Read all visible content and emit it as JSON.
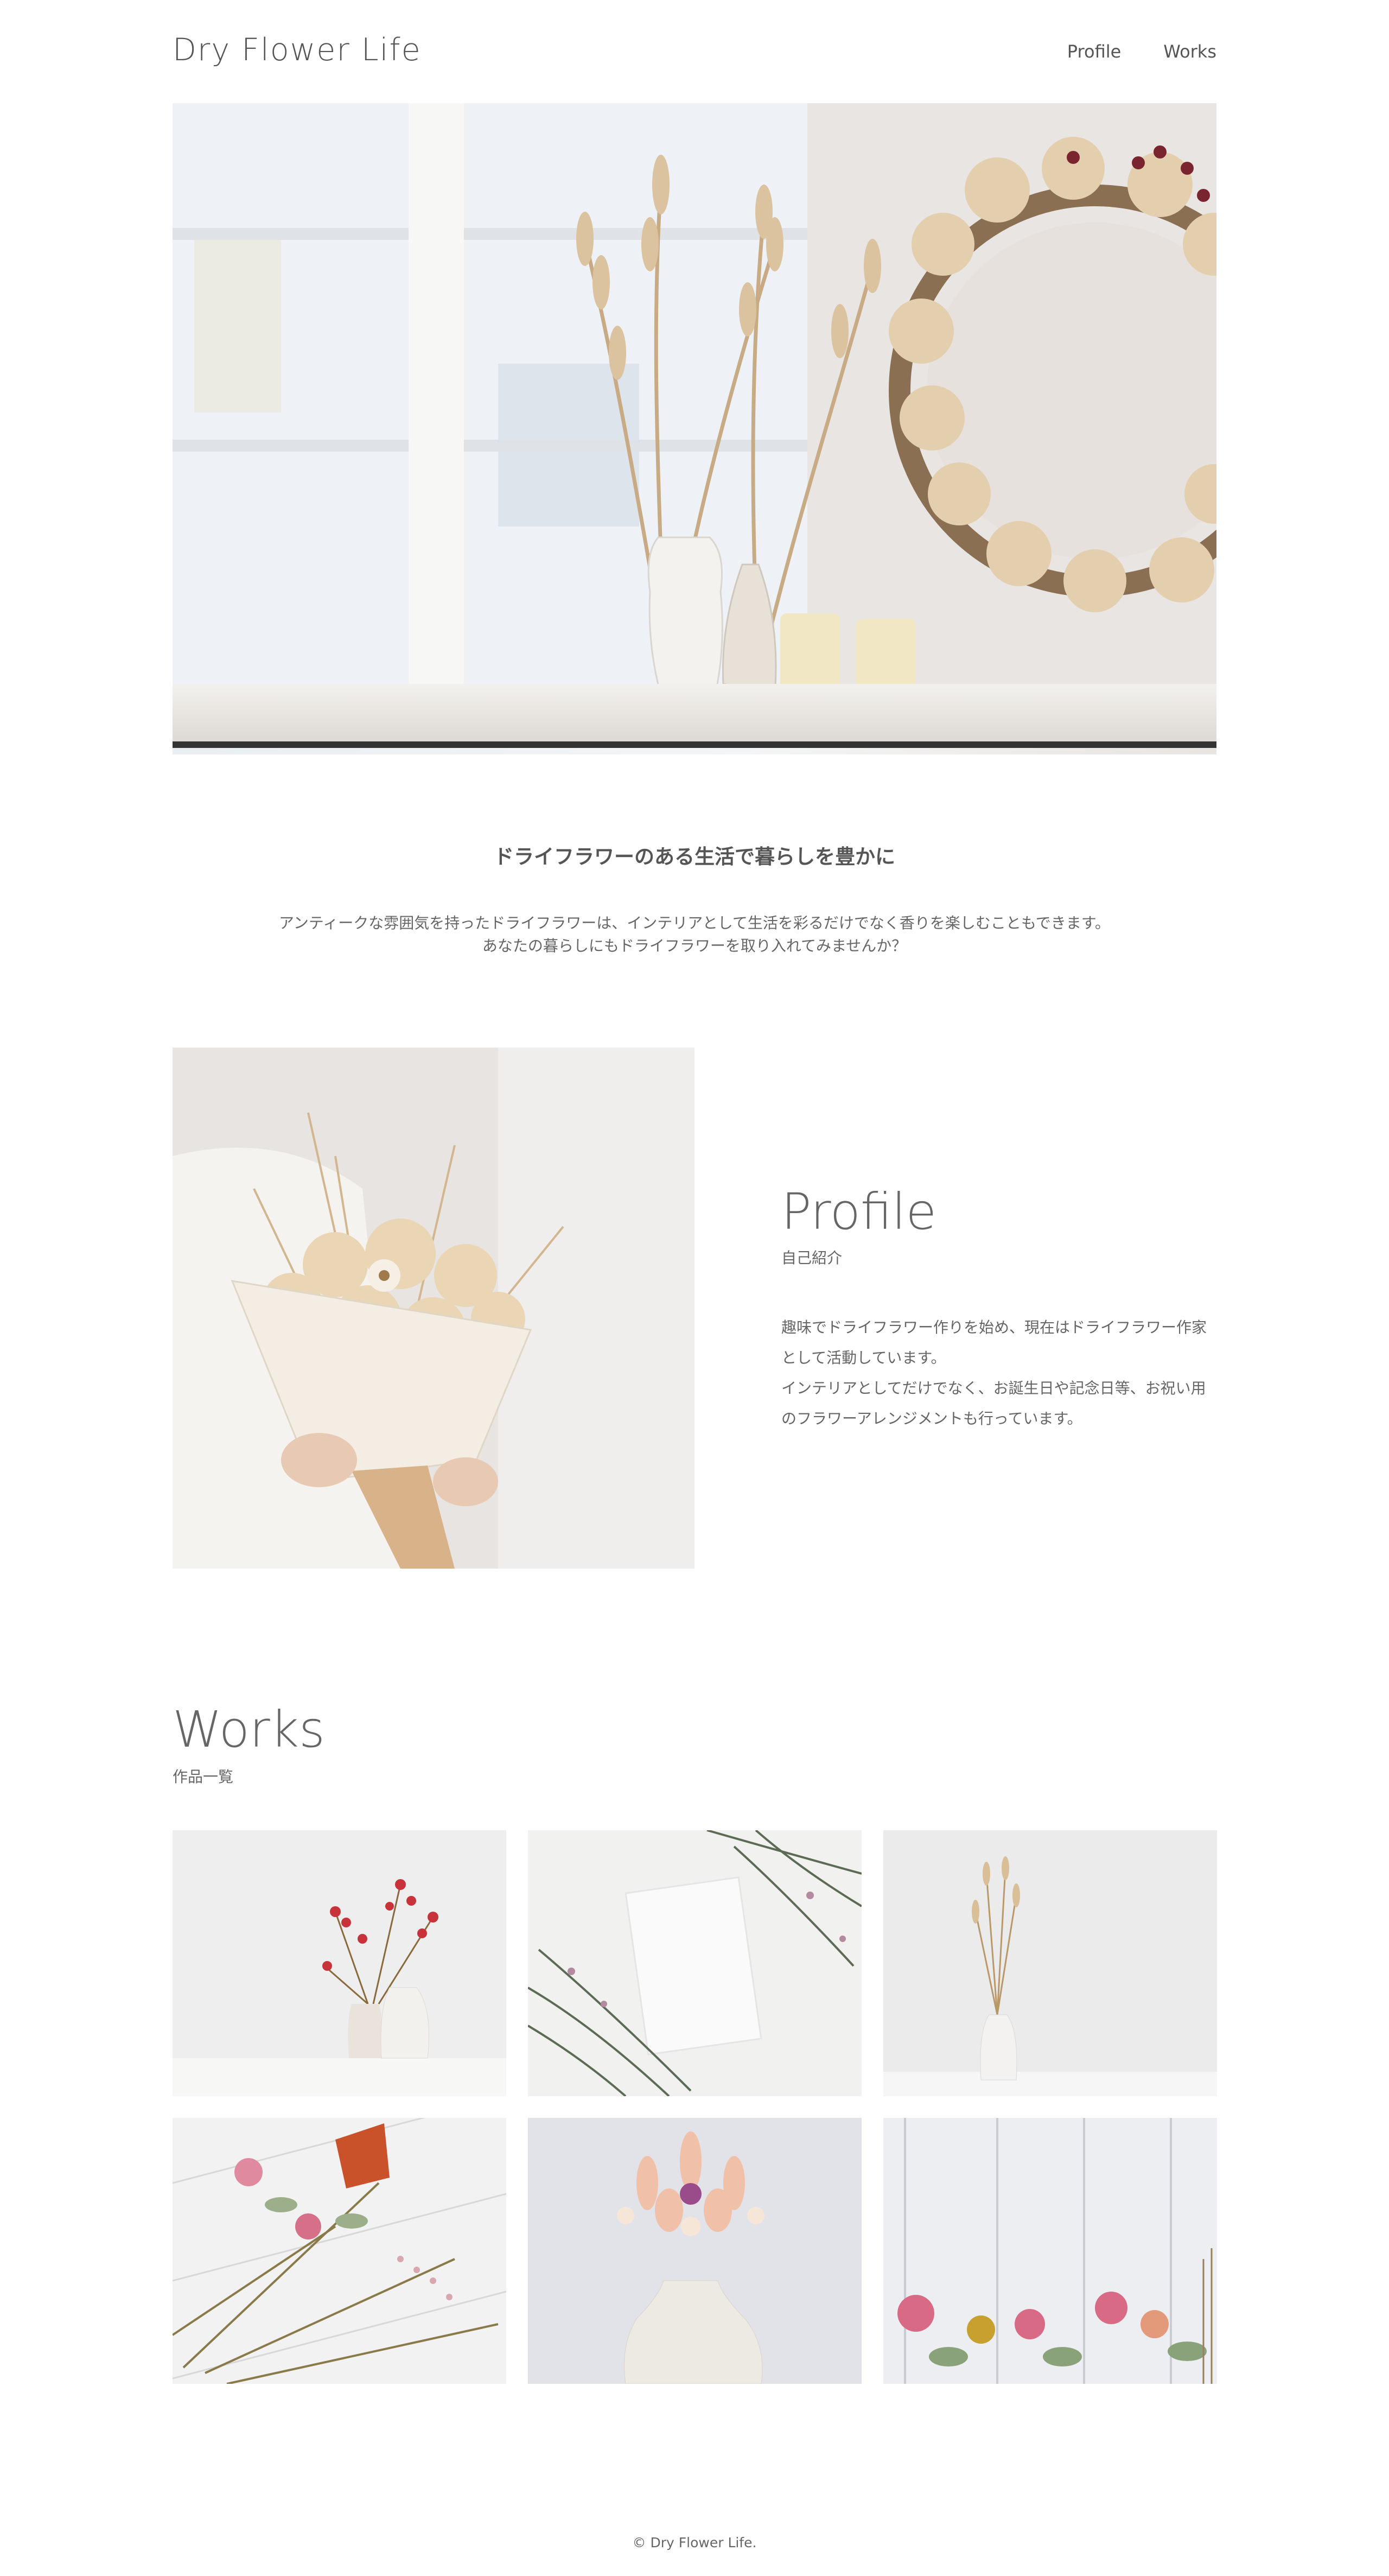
{
  "header": {
    "logo": "Dry Flower Life",
    "nav": [
      "Profile",
      "Works"
    ]
  },
  "intro": {
    "title": "ドライフラワーのある生活で暮らしを豊かに",
    "lines": [
      "アンティークな雰囲気を持ったドライフラワーは、インテリアとして生活を彩るだけでなく香りを楽しむこともできます。",
      "あなたの暮らしにもドライフラワーを取り入れてみませんか？"
    ]
  },
  "profile": {
    "title": "Profile",
    "subtitle": "自己紹介",
    "lines": [
      "趣味でドライフラワー作りを始め、現在はドライフラワー作家",
      "として活動しています。",
      "インテリアとしてだけでなく、お誕生日や記念日等、お祝い用",
      "のフラワーアレンジメントも行っています。"
    ]
  },
  "works": {
    "title": "Works",
    "subtitle": "作品一覧"
  },
  "footer": {
    "copyright": "© Dry Flower Life."
  },
  "colors": {
    "text": "#666666",
    "background": "#ffffff",
    "accent_beige": "#d8c3a0"
  }
}
